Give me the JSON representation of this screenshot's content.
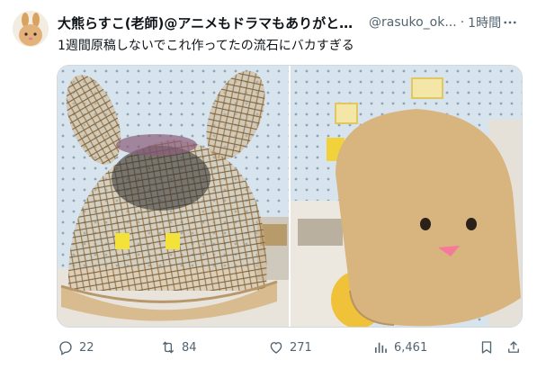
{
  "tweet": {
    "display_name": "大熊らすこ(老師)@アニメもドラマもありがとう...",
    "handle": "@rasuko_ok...",
    "separator": "·",
    "time": "1時間",
    "text": "1週間原稿しないでこれ作ってたの流石にバカすぎる"
  },
  "media": {
    "photos": [
      {
        "alt_subject": "woven rattan rabbit-head frame"
      },
      {
        "alt_subject": "fabric covered head with face"
      }
    ]
  },
  "actions": {
    "reply_count": "22",
    "retweet_count": "84",
    "like_count": "271",
    "view_count": "6,461"
  },
  "icons": {
    "more": "more-icon",
    "reply": "reply-icon",
    "retweet": "retweet-icon",
    "like": "heart-icon",
    "views": "views-icon",
    "bookmark": "bookmark-icon",
    "share": "share-icon"
  },
  "colors": {
    "text_primary": "#0f1419",
    "text_secondary": "#536471",
    "border": "#cfd9de"
  }
}
